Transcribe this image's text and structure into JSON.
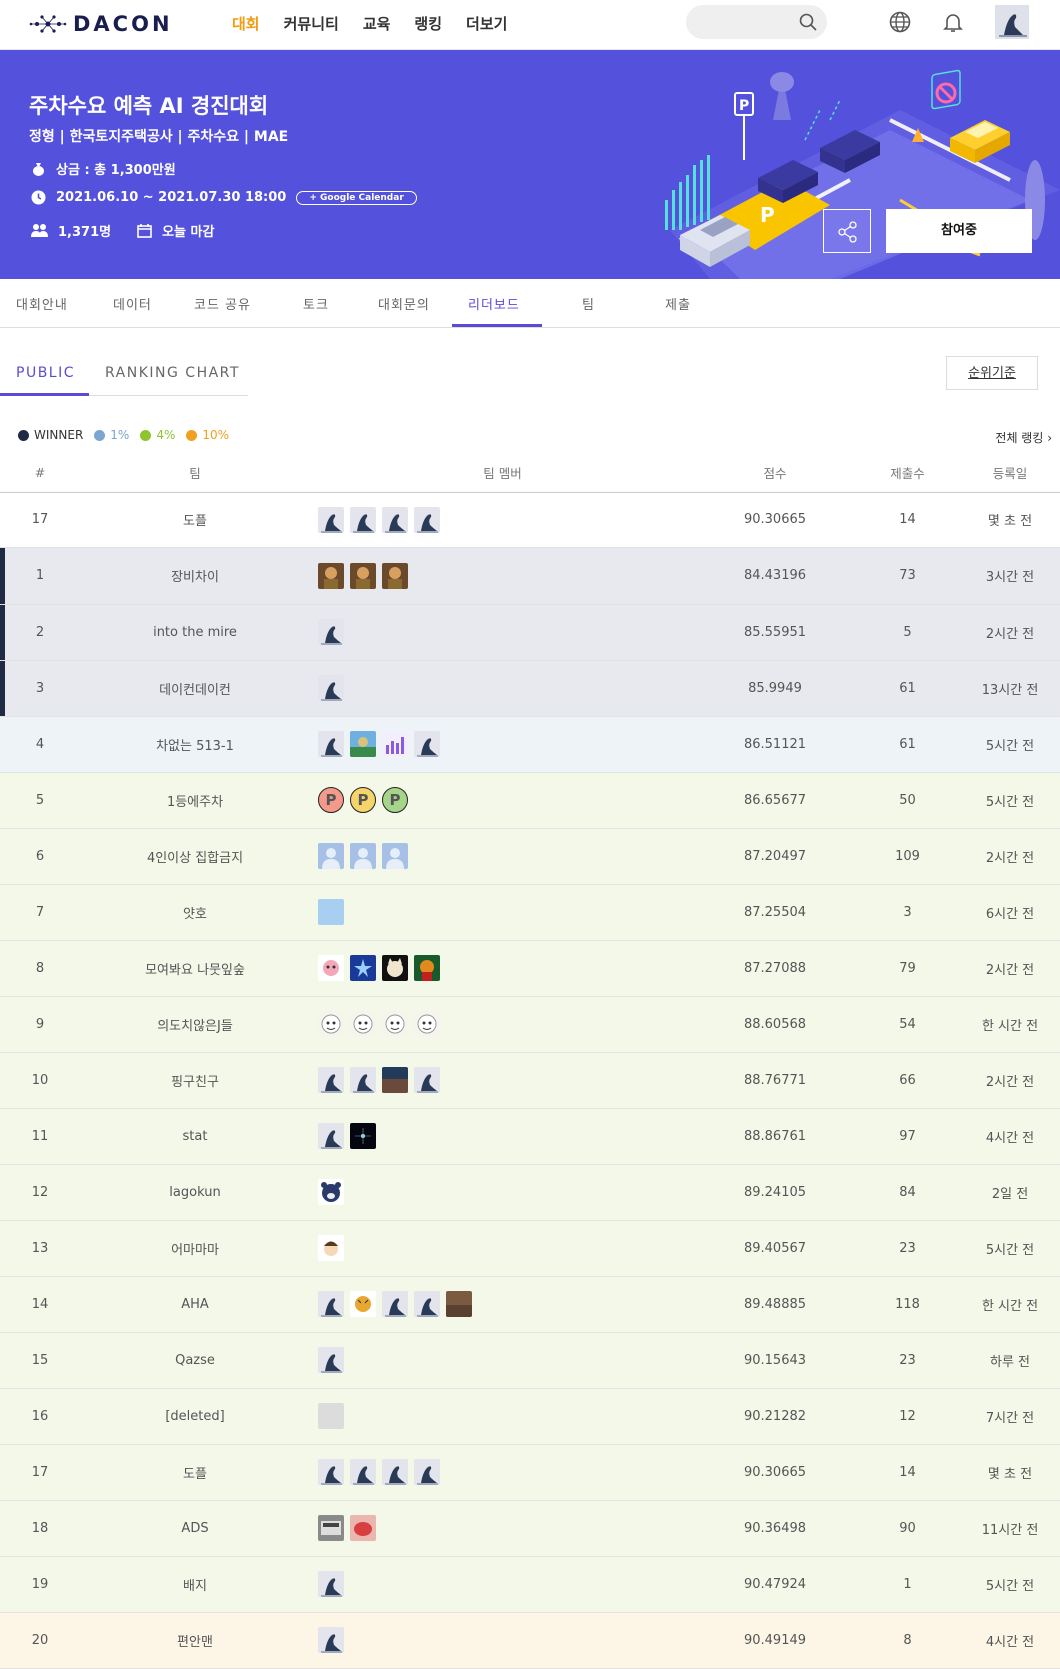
{
  "nav": {
    "logo": "DACON",
    "menu": [
      "대회",
      "커뮤니티",
      "교육",
      "랭킹",
      "더보기"
    ],
    "active_menu": "대회",
    "icons": [
      "search-icon",
      "globe-icon",
      "bell-icon"
    ]
  },
  "banner": {
    "title": "주차수요 예측 AI 경진대회",
    "subtitle": "정형 | 한국토지주택공사 | 주차수요 | MAE",
    "prize": "상금 : 총 1,300만원",
    "period": "2021.06.10 ~ 2021.07.30 18:00",
    "gcal": "+ Google Calendar",
    "participants": "1,371명",
    "deadline": "오늘 마감",
    "join_label": "참여중",
    "bg_color": "#5451dc"
  },
  "tabs": [
    "대회안내",
    "데이터",
    "코드 공유",
    "토크",
    "대회문의",
    "리더보드",
    "팀",
    "제출"
  ],
  "active_tab": "리더보드",
  "subtabs": [
    "PUBLIC",
    "RANKING CHART"
  ],
  "rank_criteria": "순위기준",
  "legend": [
    {
      "label": "WINNER",
      "color": "#1f2a44"
    },
    {
      "label": "1%",
      "color": "#7aa6d0"
    },
    {
      "label": "4%",
      "color": "#8fc330"
    },
    {
      "label": "10%",
      "color": "#f0a020"
    }
  ],
  "all_ranking": "전체 랭킹 ›",
  "columns": [
    "#",
    "팀",
    "팀 멤버",
    "점수",
    "제출수",
    "등록일"
  ],
  "my_row": {
    "rank": "17",
    "team": "도플",
    "members": [
      "penguin",
      "penguin",
      "penguin",
      "penguin"
    ],
    "score": "90.30665",
    "submissions": "14",
    "date": "몇 초 전"
  },
  "rows": [
    {
      "rank": "1",
      "team": "장비차이",
      "members": [
        "char",
        "char",
        "char"
      ],
      "score": "84.43196",
      "submissions": "73",
      "date": "3시간 전",
      "tier": "winner"
    },
    {
      "rank": "2",
      "team": "into the mire",
      "members": [
        "penguin"
      ],
      "score": "85.55951",
      "submissions": "5",
      "date": "2시간 전",
      "tier": "winner"
    },
    {
      "rank": "3",
      "team": "데이컨데이컨",
      "members": [
        "penguin"
      ],
      "score": "85.9949",
      "submissions": "61",
      "date": "13시간 전",
      "tier": "winner"
    },
    {
      "rank": "4",
      "team": "차없는 513-1",
      "members": [
        "penguin",
        "landscape",
        "chart",
        "penguin"
      ],
      "score": "86.51121",
      "submissions": "61",
      "date": "5시간 전",
      "tier": "p1"
    },
    {
      "rank": "5",
      "team": "1등에주차",
      "members": [
        "p-red",
        "p-yellow",
        "p-green"
      ],
      "score": "86.65677",
      "submissions": "50",
      "date": "5시간 전",
      "tier": "p4"
    },
    {
      "rank": "6",
      "team": "4인이상 집합금지",
      "members": [
        "user",
        "user",
        "user"
      ],
      "score": "87.20497",
      "submissions": "109",
      "date": "2시간 전",
      "tier": "p4"
    },
    {
      "rank": "7",
      "team": "얏호",
      "members": [
        "lightblue"
      ],
      "score": "87.25504",
      "submissions": "3",
      "date": "6시간 전",
      "tier": "p4"
    },
    {
      "rank": "8",
      "team": "모여봐요 나뭇잎숲",
      "members": [
        "pig",
        "star",
        "cat",
        "fox"
      ],
      "score": "87.27088",
      "submissions": "79",
      "date": "2시간 전",
      "tier": "p4"
    },
    {
      "rank": "9",
      "team": "의도치않은J들",
      "members": [
        "cartoon",
        "cartoon",
        "cartoon",
        "cartoon"
      ],
      "score": "88.60568",
      "submissions": "54",
      "date": "한 시간 전",
      "tier": "p4"
    },
    {
      "rank": "10",
      "team": "핑구친구",
      "members": [
        "penguin",
        "penguin",
        "dark",
        "penguin"
      ],
      "score": "88.76771",
      "submissions": "66",
      "date": "2시간 전",
      "tier": "p4"
    },
    {
      "rank": "11",
      "team": "stat",
      "members": [
        "penguin",
        "space"
      ],
      "score": "88.86761",
      "submissions": "97",
      "date": "4시간 전",
      "tier": "p4"
    },
    {
      "rank": "12",
      "team": "lagokun",
      "members": [
        "bear"
      ],
      "score": "89.24105",
      "submissions": "84",
      "date": "2일 전",
      "tier": "p4"
    },
    {
      "rank": "13",
      "team": "어마마마",
      "members": [
        "kid"
      ],
      "score": "89.40567",
      "submissions": "23",
      "date": "5시간 전",
      "tier": "p4"
    },
    {
      "rank": "14",
      "team": "AHA",
      "members": [
        "penguin",
        "tiger",
        "penguin",
        "penguin",
        "brown"
      ],
      "score": "89.48885",
      "submissions": "118",
      "date": "한 시간 전",
      "tier": "p4"
    },
    {
      "rank": "15",
      "team": "Qazse",
      "members": [
        "penguin"
      ],
      "score": "90.15643",
      "submissions": "23",
      "date": "하루 전",
      "tier": "p4"
    },
    {
      "rank": "16",
      "team": "[deleted]",
      "members": [
        "grey"
      ],
      "score": "90.21282",
      "submissions": "12",
      "date": "7시간 전",
      "tier": "p4"
    },
    {
      "rank": "17",
      "team": "도플",
      "members": [
        "penguin",
        "penguin",
        "penguin",
        "penguin"
      ],
      "score": "90.30665",
      "submissions": "14",
      "date": "몇 초 전",
      "tier": "p4"
    },
    {
      "rank": "18",
      "team": "ADS",
      "members": [
        "photo",
        "red"
      ],
      "score": "90.36498",
      "submissions": "90",
      "date": "11시간 전",
      "tier": "p4"
    },
    {
      "rank": "19",
      "team": "배지",
      "members": [
        "penguin"
      ],
      "score": "90.47924",
      "submissions": "1",
      "date": "5시간 전",
      "tier": "p4"
    },
    {
      "rank": "20",
      "team": "편안맨",
      "members": [
        "penguin"
      ],
      "score": "90.49149",
      "submissions": "8",
      "date": "4시간 전",
      "tier": "p10"
    }
  ]
}
